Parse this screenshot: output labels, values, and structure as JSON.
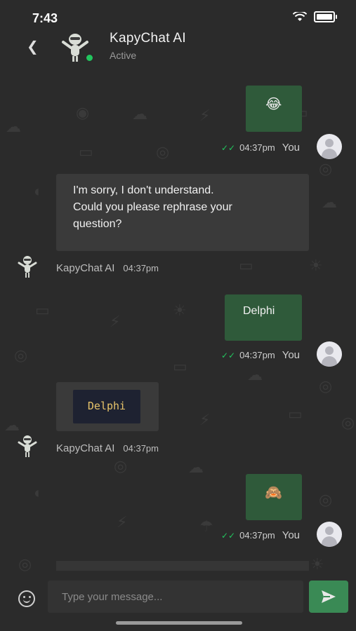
{
  "status_bar": {
    "time": "7:43"
  },
  "header": {
    "name": "KapyChat AI",
    "status": "Active"
  },
  "messages": [
    {
      "type": "outgoing",
      "emoji": "😂",
      "time": "04:37pm",
      "sender": "You"
    },
    {
      "type": "incoming",
      "text_lines": [
        "I'm sorry, I don't understand.",
        "Could you please rephrase your",
        "question?"
      ],
      "sender": "KapyChat AI",
      "time": "04:37pm"
    },
    {
      "type": "outgoing",
      "text": "Delphi",
      "time": "04:37pm",
      "sender": "You"
    },
    {
      "type": "incoming",
      "code": "Delphi",
      "sender": "KapyChat AI",
      "time": "04:37pm"
    },
    {
      "type": "outgoing",
      "emoji": "🙈",
      "time": "04:37pm",
      "sender": "You"
    }
  ],
  "composer": {
    "placeholder": "Type your message..."
  },
  "colors": {
    "accent": "#3a8a55",
    "bubble_out": "#2f5a3a",
    "online": "#22c55e"
  },
  "icons": [
    "back-chevron-icon",
    "bot-avatar-icon",
    "user-avatar-icon",
    "emoji-icon",
    "send-icon",
    "double-check-icon"
  ]
}
